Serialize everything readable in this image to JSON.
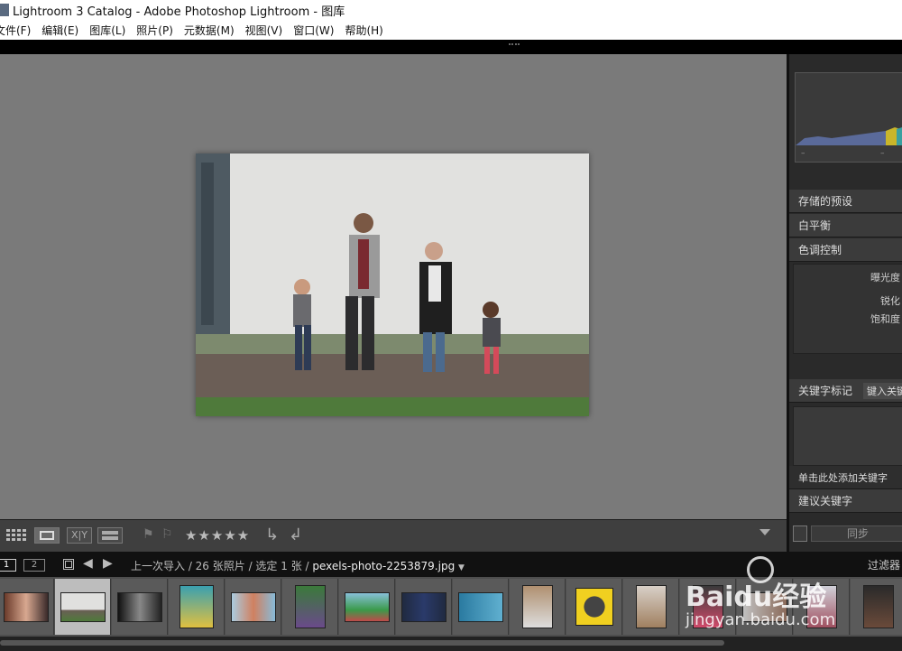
{
  "window": {
    "title": "Lightroom 3 Catalog - Adobe Photoshop Lightroom - 图库"
  },
  "menu": [
    "文件(F)",
    "编辑(E)",
    "图库(L)",
    "照片(P)",
    "元数据(M)",
    "视图(V)",
    "窗口(W)",
    "帮助(H)"
  ],
  "right_panel": {
    "rows": [
      "存储的预设",
      "白平衡",
      "色调控制"
    ],
    "sub_items": [
      "曝光度",
      "锐化",
      "饱和度"
    ],
    "keywords_header": "关键字标记",
    "keywords_input": "键入关键",
    "keywords_hint": "单击此处添加关键字",
    "suggest": "建议关键字",
    "sync_label": "同步",
    "hist_ticks": [
      "–",
      "–",
      "–"
    ]
  },
  "toolbar": {
    "xy_label": "X|Y",
    "stars": "★★★★★"
  },
  "filmstrip_header": {
    "page1": "1",
    "page2": "2",
    "source": "上一次导入 / 26 张照片 / 选定 1 张 / ",
    "filename": "pexels-photo-2253879.jpg",
    "filter": "过滤器"
  },
  "watermark": {
    "brand": "Baidu经验",
    "url": "jingyan.baidu.com"
  },
  "colors": {
    "main_bg": "#7a7a7a",
    "panel_bg": "#2a2a2a",
    "selected_thumb": "#bdbdbd"
  }
}
